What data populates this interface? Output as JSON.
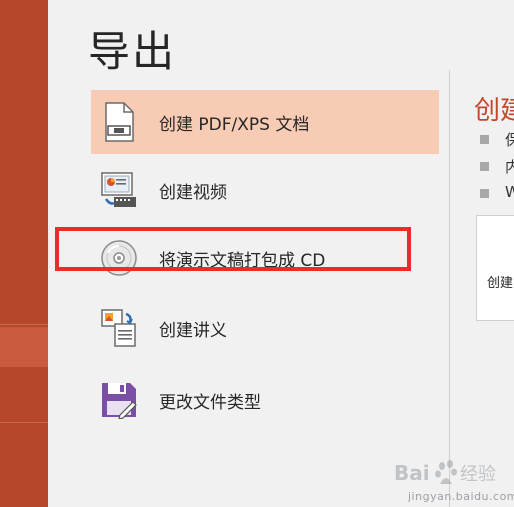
{
  "page": {
    "title": "导出"
  },
  "options": [
    {
      "label": "创建 PDF/XPS 文档",
      "icon": "pdf-document-icon",
      "selected": true
    },
    {
      "label": "创建视频",
      "icon": "video-icon",
      "selected": false
    },
    {
      "label": "将演示文稿打包成 CD",
      "icon": "cd-disc-icon",
      "selected": false
    },
    {
      "label": "创建讲义",
      "icon": "handouts-icon",
      "selected": false
    },
    {
      "label": "更改文件类型",
      "icon": "save-disk-icon",
      "selected": false
    }
  ],
  "detail": {
    "title": "创建",
    "bullets": [
      "保",
      "内",
      "W"
    ],
    "action_label": "创建"
  },
  "watermark": {
    "text": "Bai 经验",
    "sub": "jingyan.baidu.com"
  },
  "colors": {
    "accent": "#b7472a",
    "selected_bg": "#f8cbb4",
    "annotation": "#ee2a2a"
  }
}
